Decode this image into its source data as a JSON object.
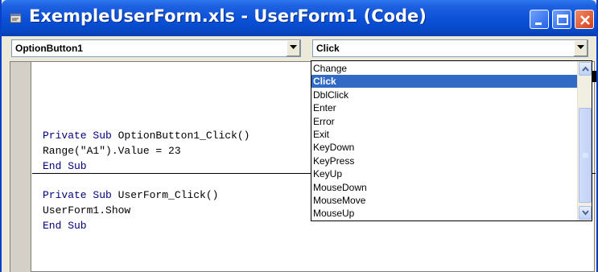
{
  "window": {
    "title": "ExempleUserForm.xls - UserForm1 (Code)",
    "app_icon": "vba-module-icon",
    "controls": {
      "minimize_icon": "minimize-icon",
      "maximize_icon": "maximize-icon",
      "close_icon": "close-icon"
    },
    "colors": {
      "titlebar": "#0a50d8",
      "selection": "#316ac5",
      "keyword": "#00007f"
    }
  },
  "combos": {
    "object_value": "OptionButton1",
    "procedure_value": "Click"
  },
  "dropdown": {
    "items": [
      "Change",
      "Click",
      "DblClick",
      "Enter",
      "Error",
      "Exit",
      "KeyDown",
      "KeyPress",
      "KeyUp",
      "MouseDown",
      "MouseMove",
      "MouseUp"
    ],
    "selected": "Click"
  },
  "code": {
    "block1": {
      "sub_kw": "Private Sub",
      "sub_name": " OptionButton1_Click()",
      "line2": "Range(\"A1\").Value = 23",
      "end_kw": "End Sub"
    },
    "block2": {
      "sub_kw": "Private Sub",
      "sub_name": " UserForm_Click()",
      "line2": "UserForm1.Show",
      "end_kw": "End Sub"
    }
  }
}
